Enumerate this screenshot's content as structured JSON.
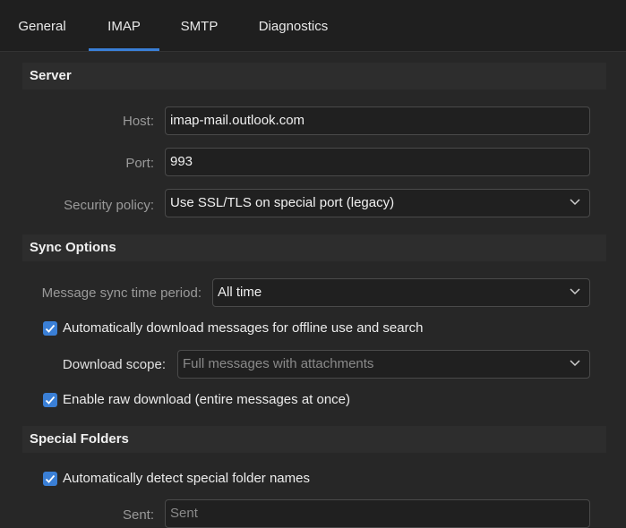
{
  "tabs": [
    {
      "label": "General"
    },
    {
      "label": "IMAP"
    },
    {
      "label": "SMTP"
    },
    {
      "label": "Diagnostics"
    }
  ],
  "active_tab": "IMAP",
  "server": {
    "title": "Server",
    "host_label": "Host:",
    "host_value": "imap-mail.outlook.com",
    "port_label": "Port:",
    "port_value": "993",
    "security_label": "Security policy:",
    "security_value": "Use SSL/TLS on special port (legacy)"
  },
  "sync": {
    "title": "Sync Options",
    "period_label": "Message sync time period:",
    "period_value": "All time",
    "auto_download_label": "Automatically download messages for offline use and search",
    "auto_download_checked": true,
    "scope_label": "Download scope:",
    "scope_value": "Full messages with attachments",
    "raw_download_label": "Enable raw download (entire messages at once)",
    "raw_download_checked": true
  },
  "folders": {
    "title": "Special Folders",
    "auto_detect_label": "Automatically detect special folder names",
    "auto_detect_checked": true,
    "sent_label": "Sent:",
    "sent_value": "Sent"
  },
  "colors": {
    "accent": "#3a7fd6",
    "background": "#272727",
    "tabbar": "#1f1f1f"
  }
}
